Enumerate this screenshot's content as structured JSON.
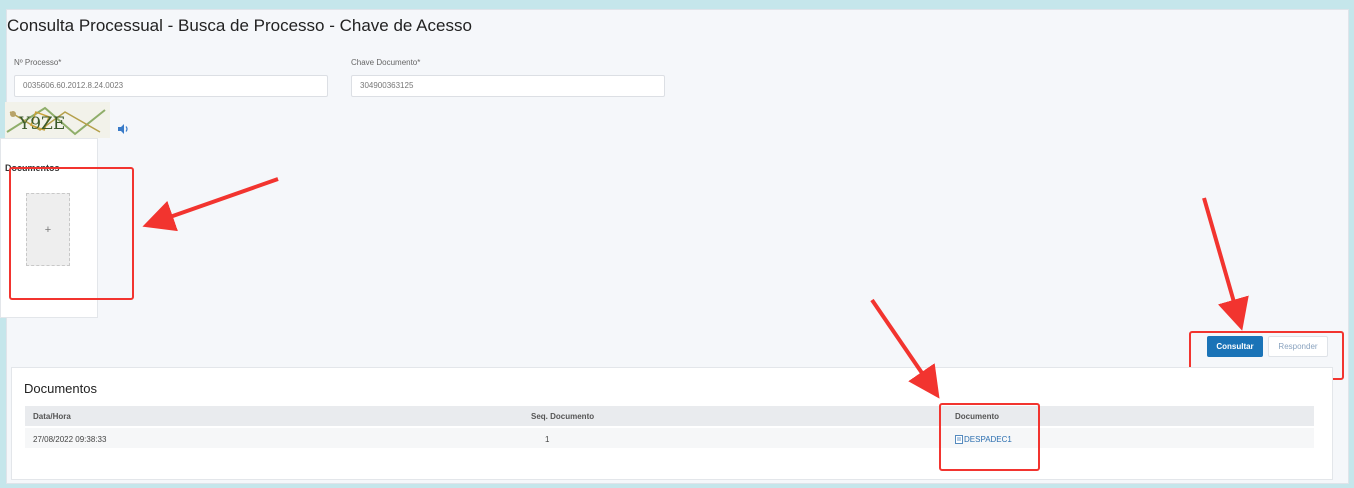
{
  "header": {
    "title": "Consulta Processual - Busca de Processo - Chave de Acesso"
  },
  "form": {
    "process_label": "Nº Processo*",
    "process_value": "0035606.60.2012.8.24.0023",
    "key_label": "Chave Documento*",
    "key_value": "304900363125",
    "captcha_text": "Y9ZE"
  },
  "upload": {
    "label": "Documentos",
    "plus": "+"
  },
  "actions": {
    "consultar_label": "Consultar",
    "responder_label": "Responder"
  },
  "results": {
    "title": "Documentos",
    "columns": [
      "Data/Hora",
      "Seq. Documento",
      "Documento"
    ],
    "rows": [
      {
        "datetime": "27/08/2022 09:38:33",
        "seq": "1",
        "document": "DESPADEC1"
      }
    ]
  },
  "colors": {
    "background": "#c5e6eb",
    "primary_button": "#1a73b7",
    "annotation_red": "#f2342f"
  }
}
